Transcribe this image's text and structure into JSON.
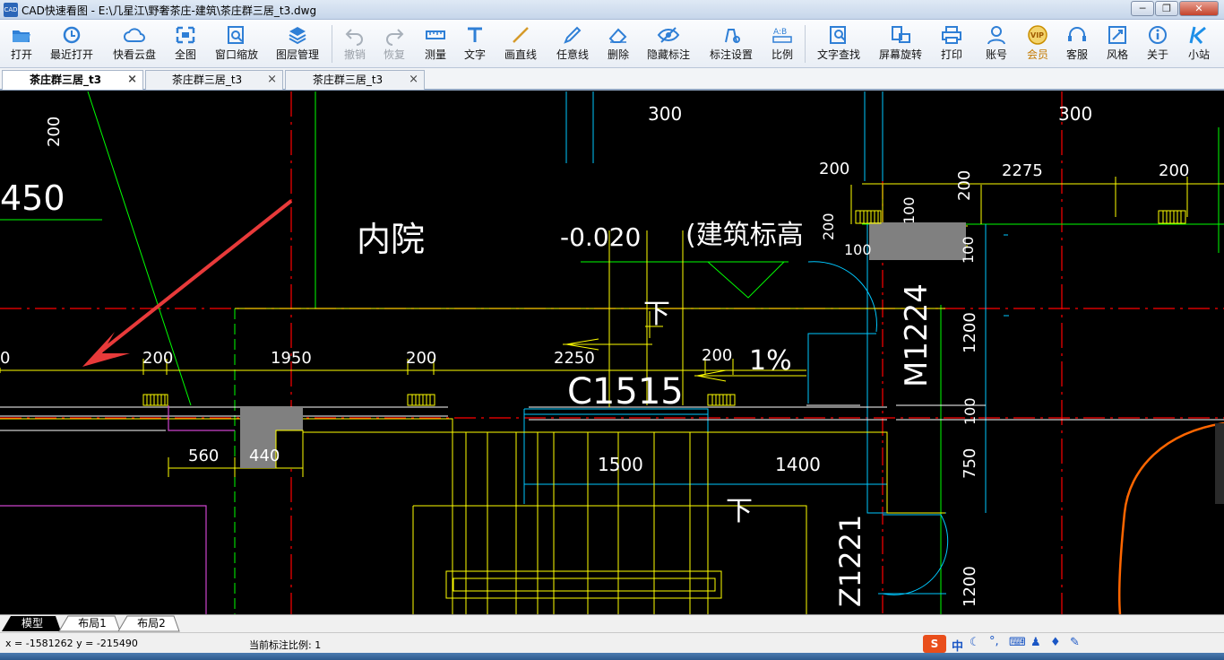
{
  "window": {
    "title": "CAD快速看图 - E:\\几星江\\野奢茶庄-建筑\\茶庄群三居_t3.dwg",
    "app_icon_text": "CAD"
  },
  "toolbar": {
    "items": [
      {
        "label": "打开",
        "icon": "open-folder-icon"
      },
      {
        "label": "最近打开",
        "icon": "recent-clock-icon"
      },
      {
        "label": "快看云盘",
        "icon": "cloud-icon"
      },
      {
        "label": "全图",
        "icon": "fit-all-icon"
      },
      {
        "label": "窗口缩放",
        "icon": "window-zoom-icon"
      },
      {
        "label": "图层管理",
        "icon": "layers-icon"
      },
      {
        "label": "撤销",
        "icon": "undo-icon"
      },
      {
        "label": "恢复",
        "icon": "redo-icon"
      },
      {
        "label": "测量",
        "icon": "measure-icon"
      },
      {
        "label": "文字",
        "icon": "text-icon"
      },
      {
        "label": "画直线",
        "icon": "line-icon"
      },
      {
        "label": "任意线",
        "icon": "pen-icon"
      },
      {
        "label": "删除",
        "icon": "eraser-icon"
      },
      {
        "label": "隐藏标注",
        "icon": "eye-hide-icon"
      },
      {
        "label": "标注设置",
        "icon": "annotation-settings-icon"
      },
      {
        "label": "比例",
        "icon": "scale-icon"
      },
      {
        "label": "文字查找",
        "icon": "text-search-icon"
      },
      {
        "label": "屏幕旋转",
        "icon": "rotate-screen-icon"
      },
      {
        "label": "打印",
        "icon": "printer-icon"
      },
      {
        "label": "账号",
        "icon": "user-icon"
      },
      {
        "label": "会员",
        "icon": "vip-icon"
      },
      {
        "label": "客服",
        "icon": "headset-icon"
      },
      {
        "label": "风格",
        "icon": "style-icon"
      },
      {
        "label": "关于",
        "icon": "info-icon"
      },
      {
        "label": "小站",
        "icon": "k-site-icon"
      }
    ]
  },
  "tabs": [
    {
      "label": "茶庄群三居_t3",
      "active": true
    },
    {
      "label": "茶庄群三居_t3",
      "active": false
    },
    {
      "label": "茶庄群三居_t3",
      "active": false
    }
  ],
  "drawing": {
    "texts": {
      "t300a": "300",
      "t300b": "300",
      "t200top": "200",
      "t450": "450",
      "t200r1": "200",
      "t2275": "2275",
      "t200r2": "200",
      "t200v1": "200",
      "t200v2": "200",
      "t100v": "100",
      "t100h": "100",
      "courtyard": "内院",
      "elev": "-0.020",
      "elev_note": "(建筑标高",
      "t100b": "100",
      "down1": "下",
      "m1224": "M1224",
      "t1200a": "1200",
      "t0": "0",
      "t200c": "200",
      "t1950": "1950",
      "t200d": "200",
      "t2250": "2250",
      "t200e": "200",
      "slope": "1%",
      "c1515": "C1515",
      "t100c": "100",
      "t560": "560",
      "t440": "440",
      "t1500": "1500",
      "t1400": "1400",
      "t750": "750",
      "down2": "下",
      "z1221": "Z1221",
      "t1200b": "1200"
    }
  },
  "layout_tabs": [
    "模型",
    "布局1",
    "布局2"
  ],
  "status": {
    "coords": "x = -1581262  y = -215490",
    "scale": "当前标注比例: 1"
  },
  "ime": {
    "logo": "S",
    "lang": "中"
  },
  "colors": {
    "bg": "#000000",
    "yellow": "#ffff00",
    "red": "#ff0000",
    "green": "#00ff00",
    "cyan": "#00c8ff",
    "white": "#ffffff",
    "gray": "#808080",
    "magenta": "#cc44cc",
    "orange": "#ff6600"
  }
}
